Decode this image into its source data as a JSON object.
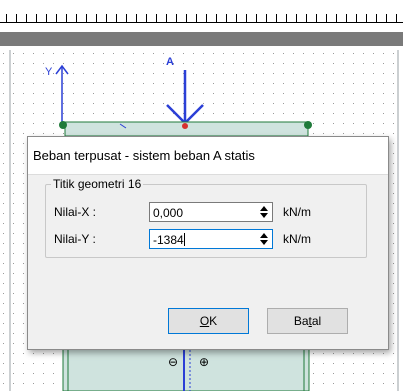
{
  "canvas": {
    "axis_y_label": "Y",
    "load_label": "A",
    "sign_minus": "⊖",
    "sign_plus": "⊕"
  },
  "dialog": {
    "title": "Beban terpusat - sistem beban A statis",
    "group_title": "Titik geometri 16",
    "x_label": "Nilai-X :",
    "x_value": "0,000",
    "x_unit": "kN/m",
    "y_label": "Nilai-Y :",
    "y_value": "-1384",
    "y_unit": "kN/m",
    "ok_label": "OK",
    "ok_mnemonic": "O",
    "ok_rest": "K",
    "cancel_label": "Batal",
    "cancel_pre": "Ba",
    "cancel_mnemonic": "t",
    "cancel_post": "al"
  }
}
